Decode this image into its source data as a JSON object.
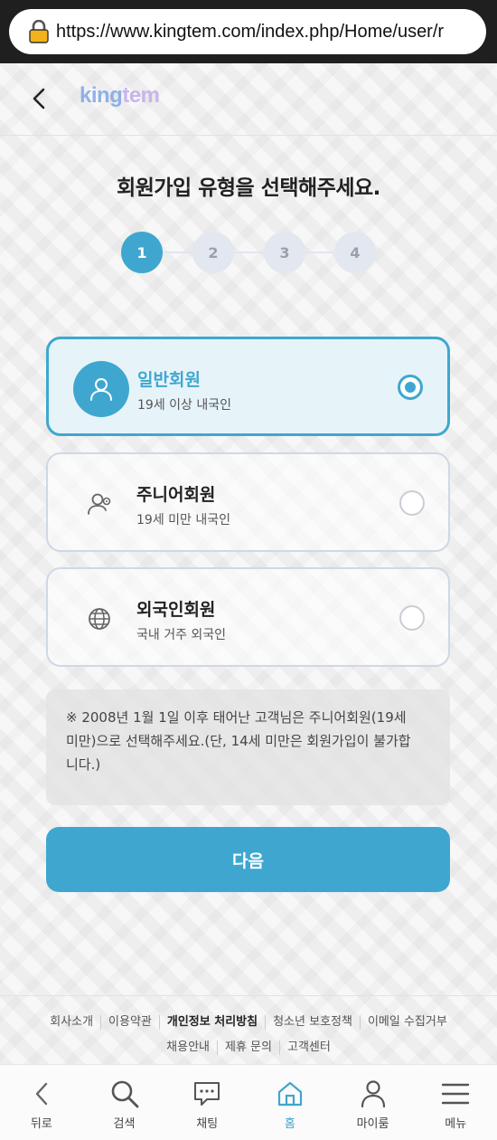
{
  "browser": {
    "url": "https://www.kingtem.com/index.php/Home/user/r"
  },
  "header": {
    "logo_part1": "king",
    "logo_part2": "tem"
  },
  "title": "회원가입 유형을 선택해주세요.",
  "steps": [
    "1",
    "2",
    "3",
    "4"
  ],
  "current_step": 1,
  "options": [
    {
      "title": "일반회원",
      "subtitle": "19세 이상 내국인",
      "icon": "user-icon",
      "selected": true
    },
    {
      "title": "주니어회원",
      "subtitle": "19세 미만 내국인",
      "icon": "junior-user-icon",
      "selected": false
    },
    {
      "title": "외국인회원",
      "subtitle": "국내 거주 외국인",
      "icon": "globe-icon",
      "selected": false
    }
  ],
  "notice": {
    "line1": "※ 2008년 1월 1일 이후 태어난 고객님은 주니어회원(19세",
    "line2": "미만)으로 선택해주세요.(단, 14세 미만은 회원가입이 불가합",
    "line3": "니다.)"
  },
  "next_button": "다음",
  "footer": {
    "row1": [
      "회사소개",
      "이용약관",
      "개인정보 처리방침",
      "청소년 보호정책",
      "이메일 수집거부"
    ],
    "row2": [
      "채용안내",
      "제휴 문의",
      "고객센터"
    ]
  },
  "bottom_nav": [
    {
      "label": "뒤로",
      "icon": "chevron-left-icon"
    },
    {
      "label": "검색",
      "icon": "search-icon"
    },
    {
      "label": "채팅",
      "icon": "chat-icon"
    },
    {
      "label": "홈",
      "icon": "home-icon",
      "active": true
    },
    {
      "label": "마이룸",
      "icon": "person-icon"
    },
    {
      "label": "메뉴",
      "icon": "menu-icon"
    }
  ],
  "colors": {
    "accent": "#3fa7cf",
    "selected_bg": "#e6f4fa",
    "browser_bar": "#1f1f1f"
  }
}
